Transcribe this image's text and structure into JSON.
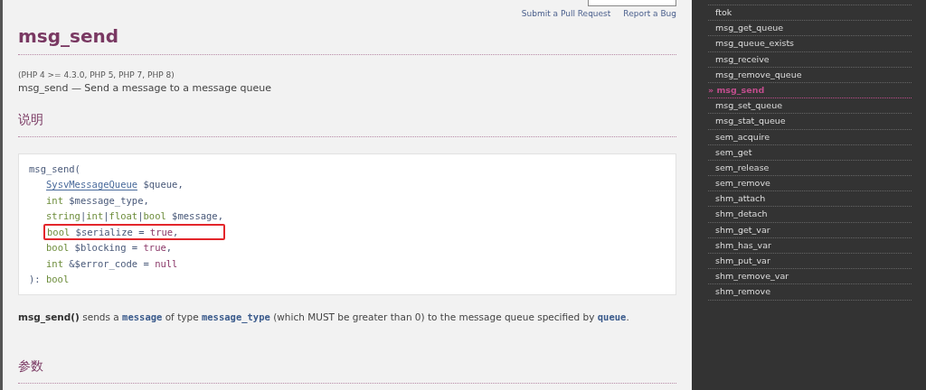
{
  "header_links": [
    "Submit a Pull Request",
    "Report a Bug"
  ],
  "title": "msg_send",
  "versions": "(PHP 4 >= 4.3.0, PHP 5, PHP 7, PHP 8)",
  "refpurpose": "msg_send — Send a message to a message queue",
  "sections": [
    "说明",
    "参数"
  ],
  "signature": {
    "opening": [
      {
        "kind": "plain",
        "text": "msg_send("
      }
    ],
    "params": [
      {
        "highlighted": false,
        "tokens": [
          {
            "kind": "link",
            "text": "SysvMessageQueue"
          },
          {
            "kind": "plain",
            "text": " $queue,"
          }
        ]
      },
      {
        "highlighted": false,
        "tokens": [
          {
            "kind": "type",
            "text": "int"
          },
          {
            "kind": "plain",
            "text": " $message_type,"
          }
        ]
      },
      {
        "highlighted": false,
        "tokens": [
          {
            "kind": "type",
            "text": "string"
          },
          {
            "kind": "plain",
            "text": "|"
          },
          {
            "kind": "type",
            "text": "int"
          },
          {
            "kind": "plain",
            "text": "|"
          },
          {
            "kind": "type",
            "text": "float"
          },
          {
            "kind": "plain",
            "text": "|"
          },
          {
            "kind": "type",
            "text": "bool"
          },
          {
            "kind": "plain",
            "text": " $message,"
          }
        ]
      },
      {
        "highlighted": true,
        "tokens": [
          {
            "kind": "type",
            "text": "bool"
          },
          {
            "kind": "plain",
            "text": " $serialize = "
          },
          {
            "kind": "value",
            "text": "true"
          },
          {
            "kind": "plain",
            "text": ","
          }
        ]
      },
      {
        "highlighted": false,
        "tokens": [
          {
            "kind": "type",
            "text": "bool"
          },
          {
            "kind": "plain",
            "text": " $blocking = "
          },
          {
            "kind": "value",
            "text": "true"
          },
          {
            "kind": "plain",
            "text": ","
          }
        ]
      },
      {
        "highlighted": false,
        "tokens": [
          {
            "kind": "type",
            "text": "int"
          },
          {
            "kind": "plain",
            "text": " &$error_code = "
          },
          {
            "kind": "value",
            "text": "null"
          }
        ]
      }
    ],
    "closing": [
      {
        "kind": "plain",
        "text": "): "
      },
      {
        "kind": "type",
        "text": "bool"
      }
    ]
  },
  "description": [
    {
      "kind": "func",
      "text": "msg_send()"
    },
    {
      "kind": "plain",
      "text": " sends a "
    },
    {
      "kind": "param",
      "text": "message"
    },
    {
      "kind": "plain",
      "text": " of type "
    },
    {
      "kind": "param",
      "text": "message_type"
    },
    {
      "kind": "plain",
      "text": " (which MUST be greater than 0) to the message queue specified by "
    },
    {
      "kind": "param",
      "text": "queue"
    },
    {
      "kind": "plain",
      "text": "."
    }
  ],
  "sidebar": [
    {
      "label": "ftok",
      "selected": false
    },
    {
      "label": "msg_get_queue",
      "selected": false
    },
    {
      "label": "msg_queue_exists",
      "selected": false
    },
    {
      "label": "msg_receive",
      "selected": false
    },
    {
      "label": "msg_remove_queue",
      "selected": false
    },
    {
      "label": "» msg_send",
      "selected": true
    },
    {
      "label": "msg_set_queue",
      "selected": false
    },
    {
      "label": "msg_stat_queue",
      "selected": false
    },
    {
      "label": "sem_acquire",
      "selected": false
    },
    {
      "label": "sem_get",
      "selected": false
    },
    {
      "label": "sem_release",
      "selected": false
    },
    {
      "label": "sem_remove",
      "selected": false
    },
    {
      "label": "shm_attach",
      "selected": false
    },
    {
      "label": "shm_detach",
      "selected": false
    },
    {
      "label": "shm_get_var",
      "selected": false
    },
    {
      "label": "shm_has_var",
      "selected": false
    },
    {
      "label": "shm_put_var",
      "selected": false
    },
    {
      "label": "shm_remove_var",
      "selected": false
    },
    {
      "label": "shm_remove",
      "selected": false
    }
  ]
}
